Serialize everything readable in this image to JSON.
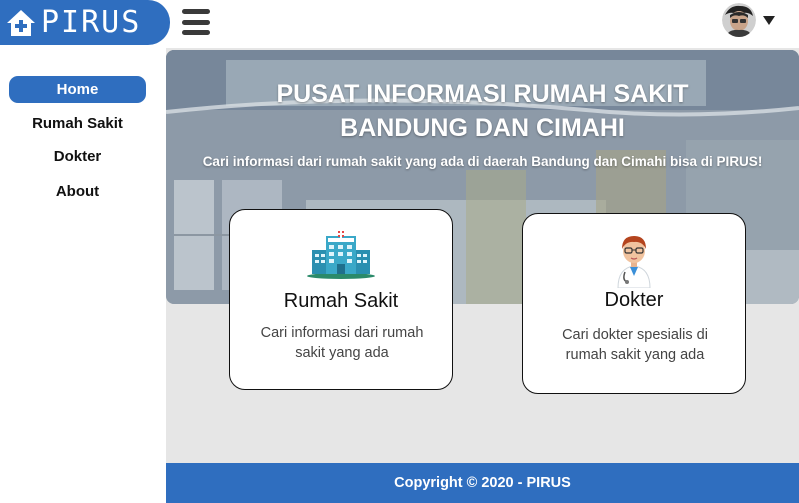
{
  "brand": {
    "name": "PIRUS",
    "icon": "home-plus-icon",
    "color": "#2f6ebf"
  },
  "header": {
    "menu_icon": "hamburger-icon",
    "user_avatar": "avatar",
    "user_menu_icon": "caret-down-icon"
  },
  "sidebar": {
    "items": [
      {
        "label": "Home",
        "active": true
      },
      {
        "label": "Rumah Sakit",
        "active": false
      },
      {
        "label": "Dokter",
        "active": false
      },
      {
        "label": "About",
        "active": false
      }
    ]
  },
  "hero": {
    "title_line1": "PUSAT INFORMASI RUMAH SAKIT",
    "title_line2": "BANDUNG DAN CIMAHI",
    "subtitle": "Cari informasi dari rumah sakit yang ada di daerah Bandung dan Cimahi bisa di PIRUS!"
  },
  "cards": [
    {
      "title": "Rumah Sakit",
      "description": "Cari informasi dari rumah sakit yang ada",
      "icon": "hospital-building-icon"
    },
    {
      "title": "Dokter",
      "description": "Cari dokter spesialis di rumah sakit yang ada",
      "icon": "doctor-icon"
    }
  ],
  "footer": {
    "text": "Copyright © 2020 - PIRUS"
  }
}
